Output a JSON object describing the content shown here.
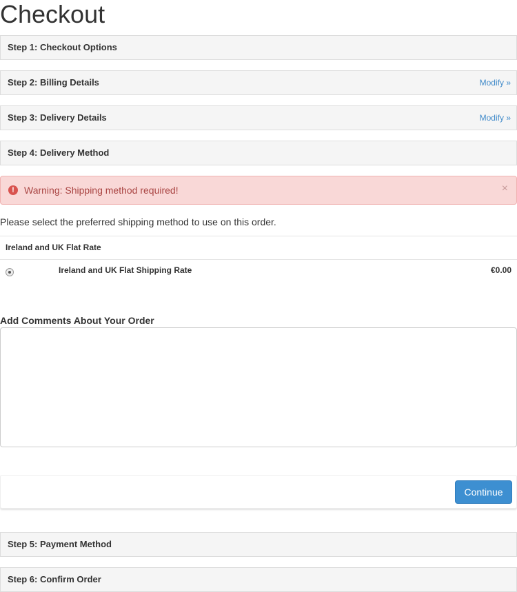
{
  "page": {
    "title": "Checkout"
  },
  "steps": [
    {
      "label": "Step 1: Checkout Options",
      "modify": ""
    },
    {
      "label": "Step 2: Billing Details",
      "modify": "Modify »"
    },
    {
      "label": "Step 3: Delivery Details",
      "modify": "Modify »"
    },
    {
      "label": "Step 4: Delivery Method",
      "modify": ""
    },
    {
      "label": "Step 5: Payment Method",
      "modify": ""
    },
    {
      "label": "Step 6: Confirm Order",
      "modify": ""
    }
  ],
  "alert": {
    "icon": "exclamation-circle-icon",
    "text": "Warning: Shipping method required!",
    "close": "×"
  },
  "delivery_method": {
    "intro": "Please select the preferred shipping method to use on this order.",
    "group_title": "Ireland and UK Flat Rate",
    "option": {
      "name": "Ireland and UK Flat Shipping Rate",
      "price": "€0.00",
      "selected": true
    }
  },
  "comments": {
    "label": "Add Comments About Your Order",
    "value": ""
  },
  "actions": {
    "continue_label": "Continue"
  },
  "colors": {
    "link": "#428bca",
    "alert_bg": "#f9d8d7",
    "alert_text": "#a94442",
    "alert_icon": "#d9534f",
    "button_bg": "#3d8fd1",
    "panel_bg": "#f5f5f5"
  }
}
